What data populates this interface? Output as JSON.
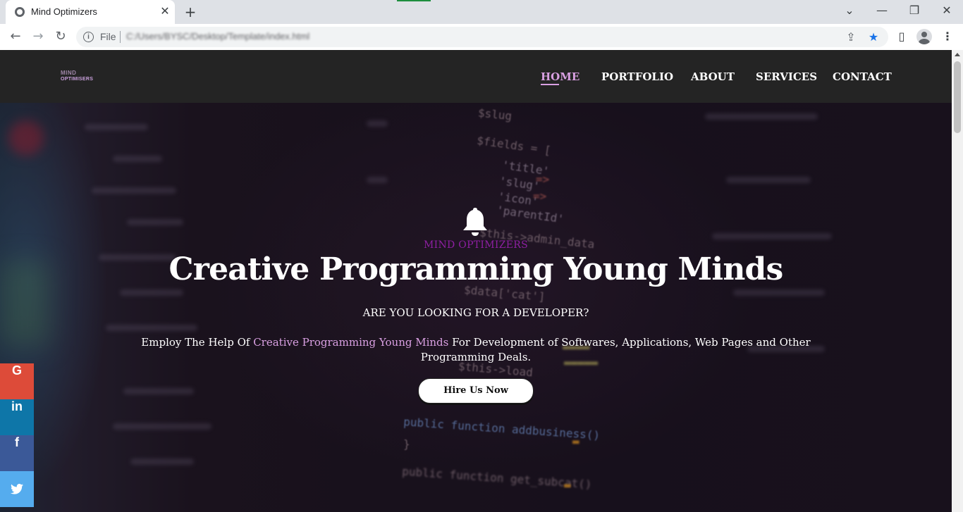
{
  "browser": {
    "tab_title": "Mind Optimizers",
    "tab_close": "✕",
    "new_tab": "+",
    "window_controls": {
      "dropdown": "⌄",
      "minimize": "—",
      "restore": "❐",
      "close": "✕"
    },
    "nav": {
      "back": "←",
      "forward": "→",
      "reload": "↻"
    },
    "scheme_label": "File",
    "url": "C:/Users/BYSC/Desktop/Template/index.html",
    "menu_glyph": "⋮"
  },
  "site": {
    "logo": {
      "line1": "MIND",
      "line2": "OPTIMISERS"
    },
    "nav": [
      {
        "label": "HOME",
        "active": true
      },
      {
        "label": "PORTFOLIO",
        "active": false
      },
      {
        "label": "ABOUT",
        "active": false
      },
      {
        "label": "SERVICES",
        "active": false
      },
      {
        "label": "CONTACT",
        "active": false
      }
    ]
  },
  "hero": {
    "eyebrow": "MIND OPTIMIZERS",
    "headline": "Creative Programming Young Minds",
    "subhead": "ARE YOU LOOKING FOR A DEVELOPER?",
    "description": {
      "before": "Employ The Help Of ",
      "highlight": "Creative Programming Young Minds",
      "after": " For Development of Softwares, Applications, Web Pages and Other Programming Deals."
    },
    "cta_label": "Hire Us Now"
  },
  "background_code": [
    "$slug",
    "$fields = [",
    "'title'",
    "'slug'",
    "'icon'",
    "'parentId'",
    "$this->admin_data",
    "$data['cat']",
    "$this->load",
    "public function addbusiness()",
    "}",
    "public function get_subcat()"
  ],
  "social": [
    {
      "name": "google",
      "glyph": "G",
      "color": "#dd4b39"
    },
    {
      "name": "linkedin",
      "glyph": "in",
      "color": "#0e76a8"
    },
    {
      "name": "facebook",
      "glyph": "f",
      "color": "#3b5998"
    },
    {
      "name": "twitter",
      "glyph": "🐦",
      "color": "#55acee"
    }
  ],
  "colors": {
    "accent": "#d9a0e2",
    "eyebrow": "#8e1fa2",
    "header_bg": "#242424"
  }
}
